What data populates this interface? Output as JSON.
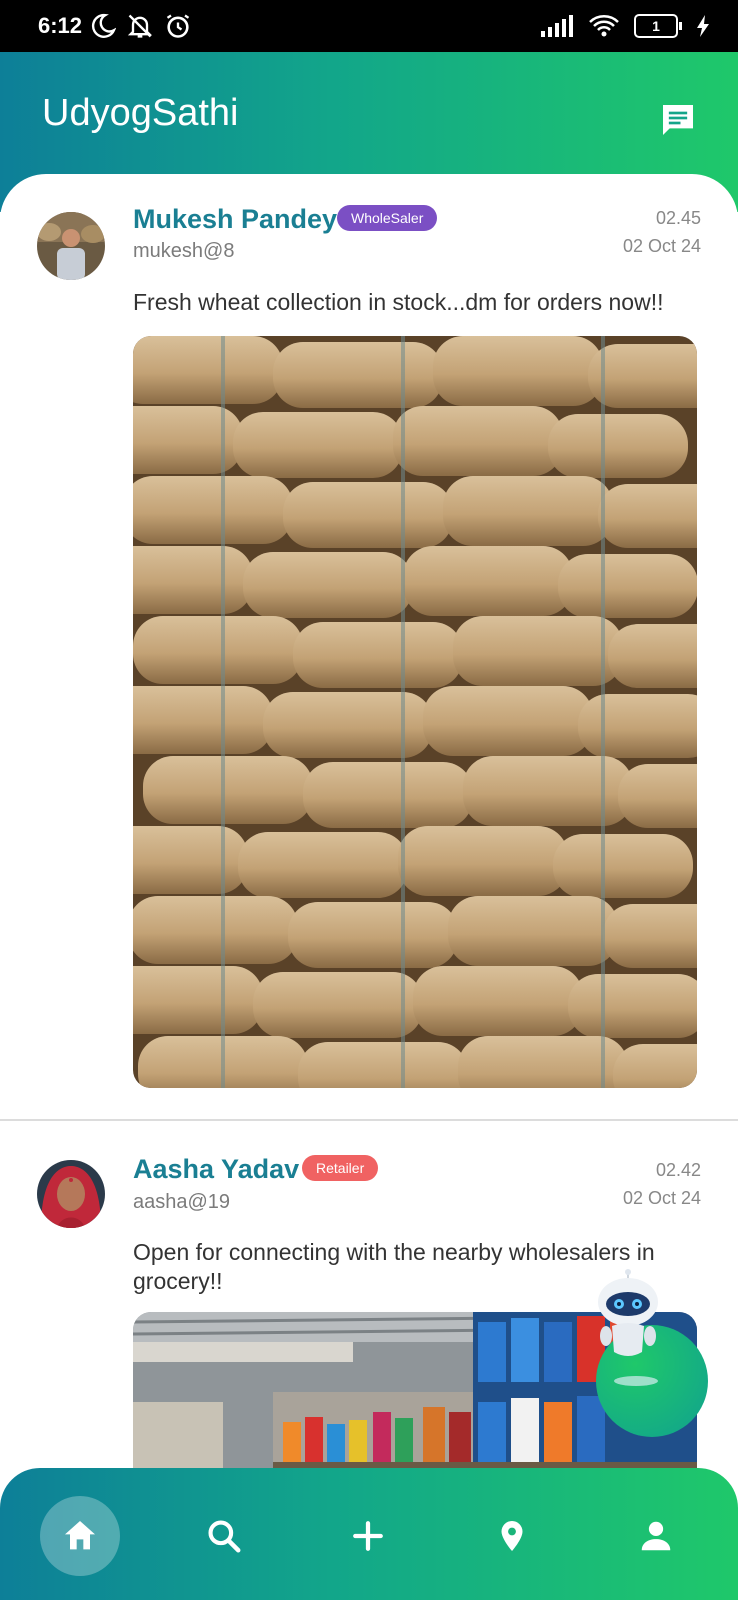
{
  "status_bar": {
    "time": "6:12",
    "battery": "1"
  },
  "app": {
    "title": "UdyogSathi"
  },
  "colors": {
    "brand_teal": "#1a7f93",
    "wholesaler_badge": "#7b4fc4",
    "retailer_badge": "#f06262",
    "gradient_start": "#0d7f98",
    "gradient_end": "#1fc86a"
  },
  "posts": [
    {
      "name": "Mukesh Pandey",
      "role": "WholeSaler",
      "handle": "mukesh@8",
      "time": "02.45",
      "date": "02 Oct 24",
      "text": "Fresh wheat collection in stock...dm for orders now!!"
    },
    {
      "name": "Aasha Yadav",
      "role": "Retailer",
      "handle": "aasha@19",
      "time": "02.42",
      "date": "02 Oct 24",
      "text": "Open for connecting with the nearby wholesalers in grocery!!"
    }
  ],
  "nav": {
    "items": [
      "home-icon",
      "search-icon",
      "add-icon",
      "location-icon",
      "profile-icon"
    ],
    "active": "home-icon"
  }
}
